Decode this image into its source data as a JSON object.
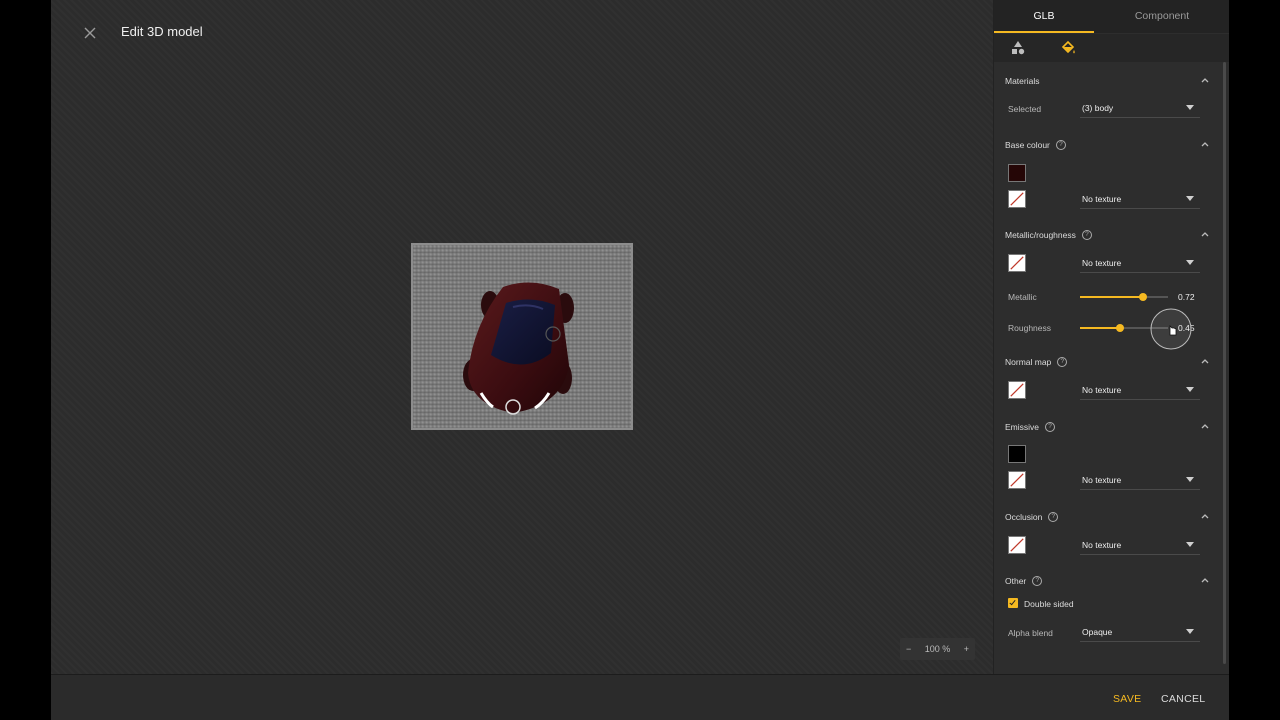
{
  "window": {
    "title": "Edit 3D model"
  },
  "zoom": {
    "minus": "−",
    "value": "100 %",
    "plus": "+"
  },
  "panel": {
    "tabs": [
      {
        "label": "GLB",
        "active": true
      },
      {
        "label": "Component",
        "active": false
      }
    ],
    "toolbar_icons": [
      "shapes-icon",
      "paint-bucket-icon"
    ],
    "materials": {
      "title": "Materials",
      "selected_label": "Selected",
      "selected_value": "(3) body"
    },
    "base_colour": {
      "title": "Base colour",
      "color": "#250606",
      "texture": "No texture"
    },
    "metallic_roughness": {
      "title": "Metallic/roughness",
      "texture": "No texture",
      "metallic_label": "Metallic",
      "metallic_value": "0.72",
      "metallic": 0.72,
      "roughness_label": "Roughness",
      "roughness_value": "0.45",
      "roughness": 0.45
    },
    "normal_map": {
      "title": "Normal map",
      "texture": "No texture"
    },
    "emissive": {
      "title": "Emissive",
      "color": "#000000",
      "texture": "No texture"
    },
    "occlusion": {
      "title": "Occlusion",
      "texture": "No texture"
    },
    "other": {
      "title": "Other",
      "double_sided_label": "Double sided",
      "double_sided": true,
      "alpha_blend_label": "Alpha blend",
      "alpha_blend_value": "Opaque"
    }
  },
  "footer": {
    "save": "SAVE",
    "cancel": "CANCEL"
  },
  "colors": {
    "accent": "#f5b921",
    "panel_bg": "#2d2d2d",
    "viewport_bg": "#2c2c2c"
  }
}
